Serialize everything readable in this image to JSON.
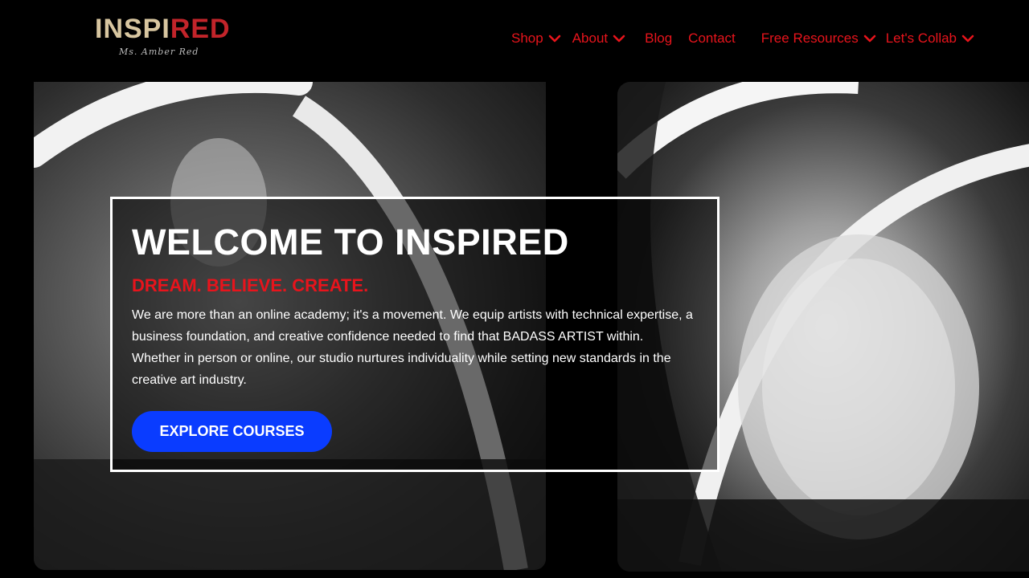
{
  "brand": {
    "logo_text_part1": "INSPI",
    "logo_text_part2": "RED",
    "logo_subtitle": "Ms. Amber Red"
  },
  "nav": {
    "items": [
      {
        "label": "Shop",
        "has_dropdown": true
      },
      {
        "label": "About",
        "has_dropdown": true
      },
      {
        "label": "Blog",
        "has_dropdown": false
      },
      {
        "label": "Contact",
        "has_dropdown": false
      },
      {
        "label": "Free Resources",
        "has_dropdown": true
      },
      {
        "label": "Let's Collab",
        "has_dropdown": true
      }
    ]
  },
  "hero": {
    "title": "WELCOME TO INSPIRED",
    "tagline": "DREAM. BELIEVE. CREATE.",
    "body": "We are more than an online academy; it's a movement. We equip artists with technical expertise, a business foundation, and creative confidence needed to find that BADASS ARTIST within. Whether in person or online, our studio nurtures individuality while setting new standards in the creative art industry.",
    "cta_label": "EXPLORE COURSES"
  },
  "colors": {
    "accent_red": "#e8141c",
    "cta_blue": "#0a3cff",
    "background": "#000000",
    "logo_gold": "#d8c6a0"
  },
  "icons": {
    "dropdown": "chevron-down-icon"
  }
}
